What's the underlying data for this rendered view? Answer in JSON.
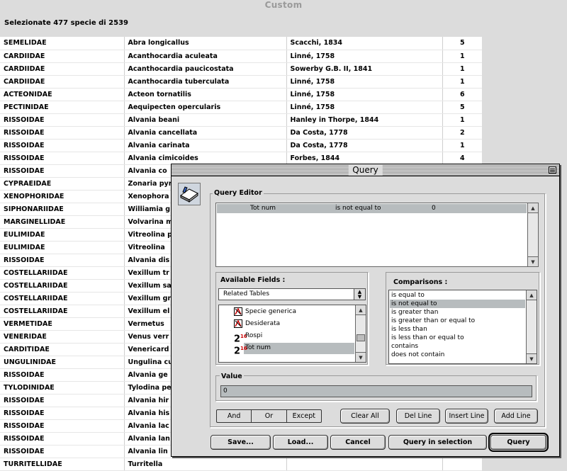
{
  "window": {
    "title": "Custom",
    "summary": "Selezionate 477 specie di 2539"
  },
  "table": {
    "rows": [
      [
        "SEMELIDAE",
        "Abra longicallus",
        "Scacchi, 1834",
        "5"
      ],
      [
        "CARDIIDAE",
        "Acanthocardia aculeata",
        "Linné, 1758",
        "1"
      ],
      [
        "CARDIIDAE",
        "Acanthocardia paucicostata",
        "Sowerby G.B. II, 1841",
        "1"
      ],
      [
        "CARDIIDAE",
        "Acanthocardia tuberculata",
        "Linné, 1758",
        "1"
      ],
      [
        "ACTEONIDAE",
        "Acteon tornatilis",
        "Linné, 1758",
        "6"
      ],
      [
        "PECTINIDAE",
        "Aequipecten opercularis",
        "Linné, 1758",
        "5"
      ],
      [
        "RISSOIDAE",
        "Alvania beani",
        "Hanley in Thorpe, 1844",
        "1"
      ],
      [
        "RISSOIDAE",
        "Alvania cancellata",
        "Da Costa, 1778",
        "2"
      ],
      [
        "RISSOIDAE",
        "Alvania carinata",
        "Da Costa, 1778",
        "1"
      ],
      [
        "RISSOIDAE",
        "Alvania cimicoides",
        "Forbes, 1844",
        "4"
      ],
      [
        "RISSOIDAE",
        "Alvania co",
        "",
        ""
      ],
      [
        "CYPRAEIDAE",
        "Zonaria pyr",
        "",
        ""
      ],
      [
        "XENOPHORIDAE",
        "Xenophora",
        "",
        ""
      ],
      [
        "SIPHONARIIDAE",
        "Williamia g",
        "",
        ""
      ],
      [
        "MARGINELLIDAE",
        "Volvarina m",
        "",
        ""
      ],
      [
        "EULIMIDAE",
        "Vitreolina p",
        "",
        ""
      ],
      [
        "EULIMIDAE",
        "Vitreolina",
        "",
        ""
      ],
      [
        "RISSOIDAE",
        "Alvania dis",
        "",
        ""
      ],
      [
        "COSTELLARIIDAE",
        "Vexillum tr",
        "",
        ""
      ],
      [
        "COSTELLARIIDAE",
        "Vexillum sa",
        "",
        ""
      ],
      [
        "COSTELLARIIDAE",
        "Vexillum gr",
        "",
        ""
      ],
      [
        "COSTELLARIIDAE",
        "Vexillum el",
        "",
        ""
      ],
      [
        "VERMETIDAE",
        "Vermetus",
        "",
        ""
      ],
      [
        "VENERIDAE",
        "Venus verr",
        "",
        ""
      ],
      [
        "CARDITIDAE",
        "Venericard",
        "",
        ""
      ],
      [
        "UNGULINIDAE",
        "Ungulina cu",
        "",
        ""
      ],
      [
        "RISSOIDAE",
        "Alvania ge",
        "",
        ""
      ],
      [
        "TYLODINIDAE",
        "Tylodina pe",
        "",
        ""
      ],
      [
        "RISSOIDAE",
        "Alvania hir",
        "",
        ""
      ],
      [
        "RISSOIDAE",
        "Alvania his",
        "",
        ""
      ],
      [
        "RISSOIDAE",
        "Alvania lac",
        "",
        ""
      ],
      [
        "RISSOIDAE",
        "Alvania lan",
        "",
        ""
      ],
      [
        "RISSOIDAE",
        "Alvania lin",
        "",
        ""
      ],
      [
        "TURRITELLIDAE",
        "Turritella",
        "",
        ""
      ]
    ]
  },
  "dialog": {
    "title": "Query",
    "query_editor": {
      "label": "Query Editor",
      "line": {
        "field": "Tot num",
        "operator": "is not equal to",
        "value": "0"
      }
    },
    "available_fields": {
      "label": "Available Fields :",
      "selector": "Related Tables",
      "items": [
        {
          "label": "Specie generica",
          "icon": "text-field-icon"
        },
        {
          "label": "Desiderata",
          "icon": "text-field-icon"
        },
        {
          "label": "Rospi",
          "icon": "numeric-field-icon",
          "glyph": "2",
          "sup": "16"
        },
        {
          "label": "Tot num",
          "icon": "numeric-field-icon",
          "glyph": "2",
          "sup": "16"
        }
      ]
    },
    "comparisons": {
      "label": "Comparisons :",
      "items": [
        "is equal to",
        "is not equal to",
        "is greater than",
        "is greater than or equal to",
        "is less than",
        "is less than or equal to",
        "contains",
        "does not contain"
      ]
    },
    "value": {
      "label": "Value",
      "current": "0"
    },
    "logic": {
      "and": "And",
      "or": "Or",
      "except": "Except"
    },
    "line_buttons": {
      "clear_all": "Clear All",
      "del_line": "Del Line",
      "insert_line": "Insert Line",
      "add_line": "Add Line"
    },
    "bottom_buttons": {
      "save": "Save...",
      "load": "Load...",
      "cancel": "Cancel",
      "query_in_selection": "Query in selection",
      "query": "Query"
    }
  }
}
